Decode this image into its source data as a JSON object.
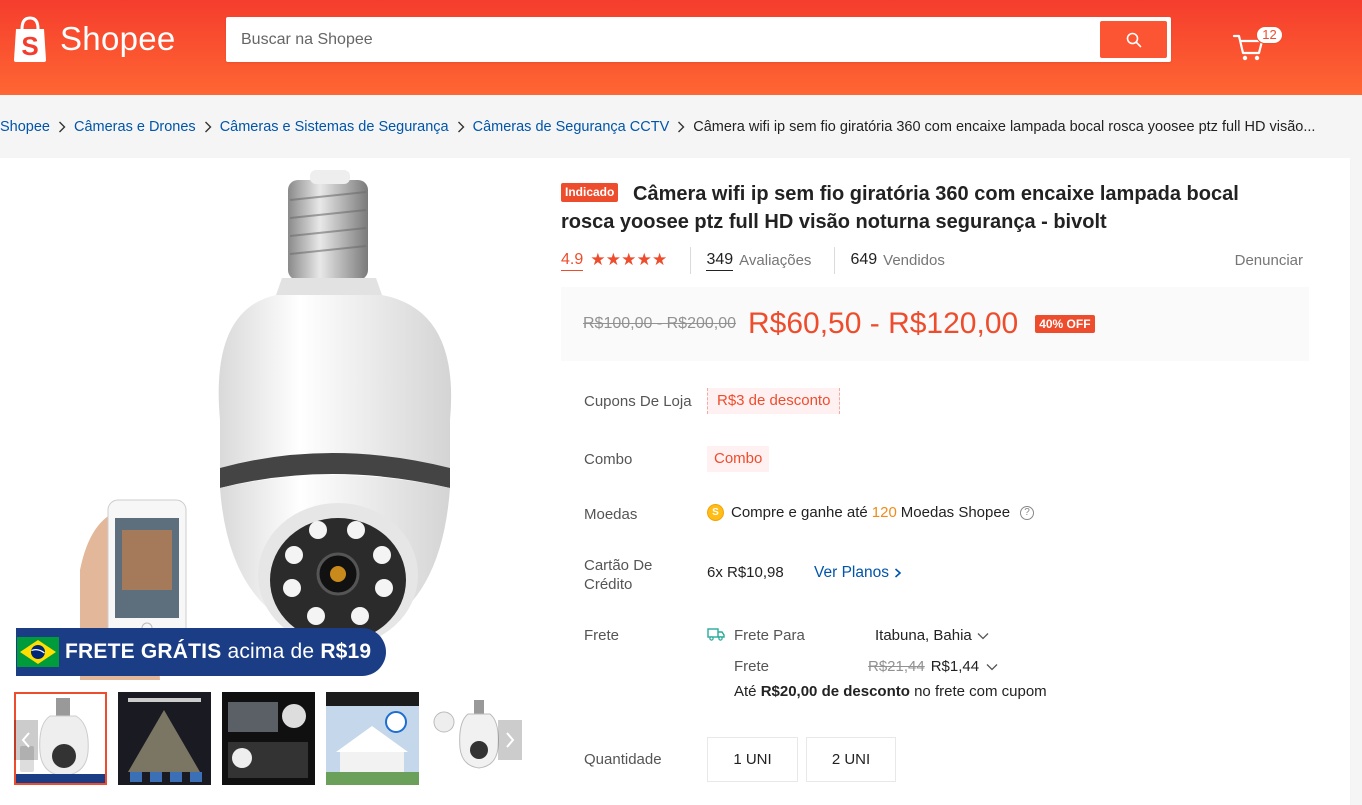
{
  "header": {
    "logo_text": "Shopee",
    "search_placeholder": "Buscar na Shopee",
    "cart_count": "12",
    "brand_color": "#ee4d2d"
  },
  "breadcrumb": {
    "items": [
      "Shopee",
      "Câmeras e Drones",
      "Câmeras e Sistemas de Segurança",
      "Câmeras de Segurança CCTV"
    ],
    "current": "Câmera wifi ip sem fio giratória 360 com encaixe lampada bocal rosca yoosee ptz full HD visão..."
  },
  "gallery": {
    "banner_bold": "FRETE GRÁTIS",
    "banner_light": "acima de",
    "banner_value": "R$19",
    "thumb_count": 5
  },
  "product": {
    "tag": "Indicado",
    "title": "Câmera wifi ip sem fio giratória 360 com encaixe lampada bocal rosca yoosee ptz full HD visão noturna segurança - bivolt",
    "rating": "4.9",
    "stars": "★★★★★",
    "reviews_count": "349",
    "reviews_label": "Avaliações",
    "sold_count": "649",
    "sold_label": "Vendidos",
    "report_label": "Denunciar"
  },
  "price": {
    "old": "R$100,00 - R$200,00",
    "new": "R$60,50 - R$120,00",
    "discount": "40% OFF"
  },
  "details": {
    "coupons_label": "Cupons De Loja",
    "coupon_value": "R$3 de desconto",
    "combo_label": "Combo",
    "combo_value": "Combo",
    "coins_label": "Moedas",
    "coins_prefix": "Compre e ganhe até",
    "coins_amount": "120",
    "coins_suffix": "Moedas Shopee",
    "card_label_1": "Cartão De",
    "card_label_2": "Crédito",
    "installment": "6x R$10,98",
    "plans_link": "Ver Planos",
    "shipping_label": "Frete",
    "ship_to_label": "Frete Para",
    "ship_to_value": "Itabuna, Bahia",
    "ship_fee_label": "Frete",
    "ship_fee_old": "R$21,44",
    "ship_fee_new": "R$1,44",
    "ship_note_prefix": "Até",
    "ship_note_bold": "R$20,00 de desconto",
    "ship_note_suffix": "no frete com cupom",
    "quantity_label": "Quantidade",
    "options": [
      "1 UNI",
      "2 UNI"
    ]
  }
}
